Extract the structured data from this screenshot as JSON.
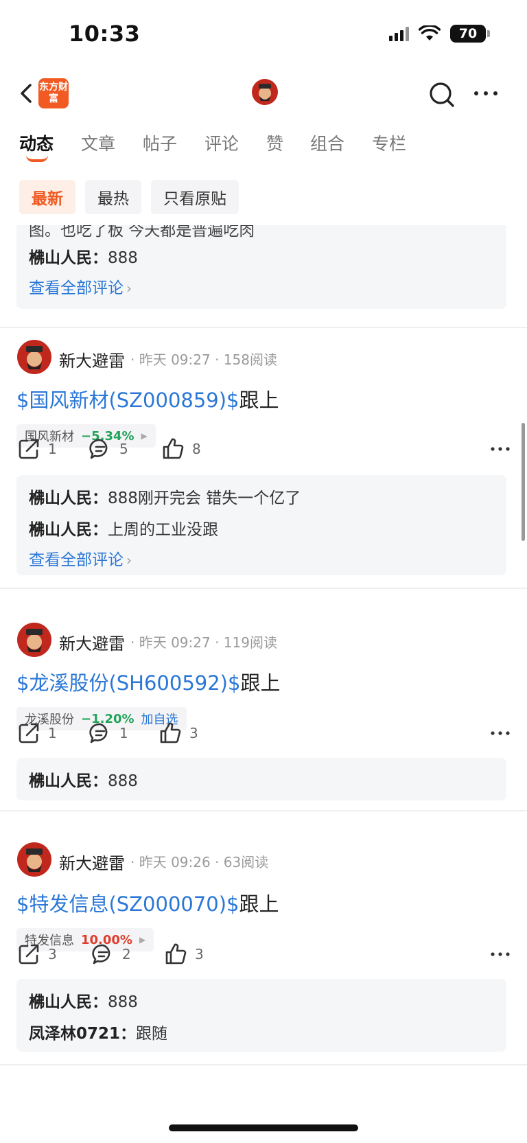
{
  "status": {
    "time": "10:33",
    "battery": "70"
  },
  "header": {
    "logo_text": "东方财富"
  },
  "tabs": [
    "动态",
    "文章",
    "帖子",
    "评论",
    "赞",
    "组合",
    "专栏"
  ],
  "filters": [
    "最新",
    "最热",
    "只看原贴"
  ],
  "top_card": {
    "partial_text": "图。也吃了板 今天都是普遍吃肉",
    "comments": [
      {
        "user": "梻山人民：",
        "text": "888"
      }
    ],
    "view_all": "查看全部评论"
  },
  "posts": [
    {
      "author": "新大避雷",
      "meta": "· 昨天 09:27 · 158阅读",
      "ticker": "$国风新材(SZ000859)$",
      "tail": "跟上",
      "tag_name": "国风新材",
      "tag_pct": "−5.34%",
      "share": "1",
      "comments": "5",
      "likes": "8",
      "replies": [
        {
          "user": "梻山人民：",
          "text": "888刚开完会 错失一个亿了"
        },
        {
          "user": "梻山人民：",
          "text": "上周的工业没跟"
        }
      ],
      "view_all": "查看全部评论"
    },
    {
      "author": "新大避雷",
      "meta": "· 昨天 09:27 · 119阅读",
      "ticker": "$龙溪股份(SH600592)$",
      "tail": "跟上",
      "tag_name": "龙溪股份",
      "tag_pct": "−1.20%",
      "tag_add": "加自选",
      "share": "1",
      "comments": "1",
      "likes": "3",
      "replies": [
        {
          "user": "梻山人民：",
          "text": "888"
        }
      ]
    },
    {
      "author": "新大避雷",
      "meta": "· 昨天 09:26 · 63阅读",
      "ticker": "$特发信息(SZ000070)$",
      "tail": "跟上",
      "tag_name": "特发信息",
      "tag_pct": "10.00%",
      "share": "3",
      "comments": "2",
      "likes": "3",
      "replies": [
        {
          "user": "梻山人民：",
          "text": "888"
        },
        {
          "user": "凤泽林0721：",
          "text": "跟随"
        }
      ]
    }
  ],
  "colors": {
    "brand": "#f15a22",
    "link": "#2a77d6",
    "down": "#22a35a",
    "up": "#e03c2c"
  }
}
